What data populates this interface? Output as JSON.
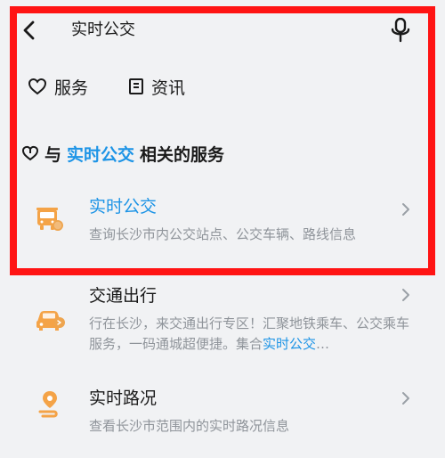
{
  "search": {
    "query": "实时公交"
  },
  "tabs": [
    {
      "label": "服务"
    },
    {
      "label": "资讯"
    }
  ],
  "section": {
    "prefix": "与",
    "highlight": "实时公交",
    "suffix": "相关的服务"
  },
  "services": [
    {
      "title": "实时公交",
      "description": "查询长沙市内公交站点、公交车辆、路线信息"
    },
    {
      "title": "交通出行",
      "description": "行在长沙，来交通出行专区！汇聚地铁乘车、公交乘车服务，一码通城超便捷。集合",
      "description_highlight": "实时公交",
      "description_suffix": "…"
    },
    {
      "title": "实时路况",
      "description": "查看长沙市范围内的实时路况信息"
    }
  ],
  "colors": {
    "accent": "#1d94e6",
    "highlight_frame": "#ff1414",
    "icon_orange": "#f4a347",
    "muted_text": "#8f949a"
  },
  "icons": {
    "back": "chevron-left",
    "mic": "microphone",
    "services_tab": "heart",
    "news_tab": "news-card",
    "service_1": "bus",
    "service_2": "car",
    "service_3": "location-route"
  }
}
